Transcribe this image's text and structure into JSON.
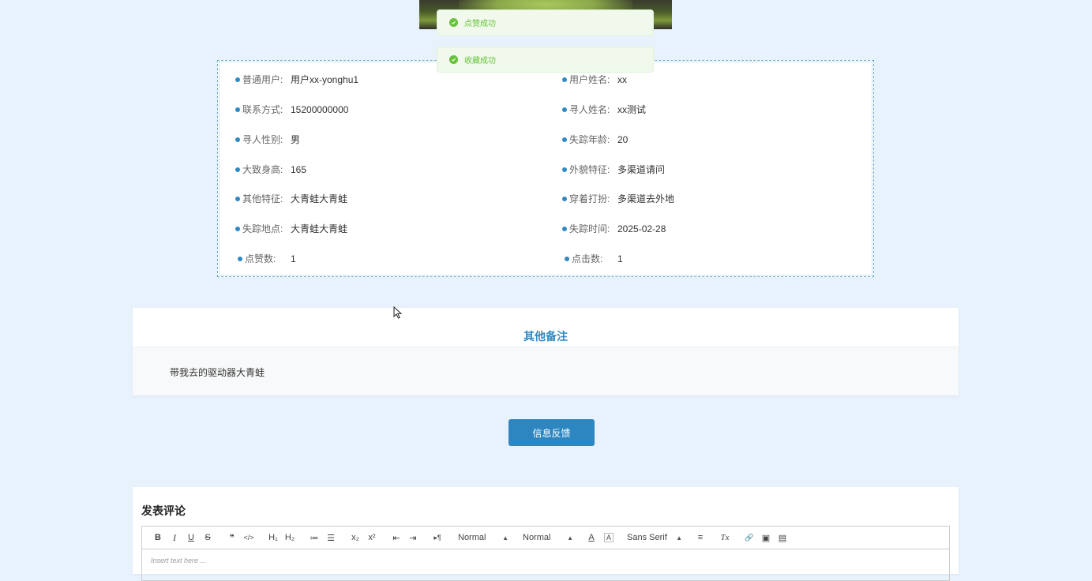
{
  "toasts": {
    "like": "点赞成功",
    "favorite": "收藏成功"
  },
  "info": {
    "left": [
      {
        "label": "普通用户:",
        "value": "用户xx-yonghu1"
      },
      {
        "label": "联系方式:",
        "value": "15200000000"
      },
      {
        "label": "寻人性别:",
        "value": "男"
      },
      {
        "label": "大致身高:",
        "value": "165"
      },
      {
        "label": "其他特征:",
        "value": "大青蛙大青蛙"
      },
      {
        "label": "失踪地点:",
        "value": "大青蛙大青蛙"
      },
      {
        "label": "点赞数:",
        "value": "1"
      }
    ],
    "right": [
      {
        "label": "用户姓名:",
        "value": "xx"
      },
      {
        "label": "寻人姓名:",
        "value": "xx测试"
      },
      {
        "label": "失踪年龄:",
        "value": "20"
      },
      {
        "label": "外貌特征:",
        "value": "多渠道请问"
      },
      {
        "label": "穿着打扮:",
        "value": "多渠道去外地"
      },
      {
        "label": "失踪时间:",
        "value": "2025-02-28"
      },
      {
        "label": "点击数:",
        "value": "1"
      }
    ]
  },
  "remarks": {
    "title": "其他备注",
    "text": "带我去的驱动器大青蛙"
  },
  "feedback_button": "信息反馈",
  "comment": {
    "title": "发表评论",
    "toolbar": {
      "bold": "B",
      "italic": "I",
      "underline": "U",
      "strike": "S",
      "blockquote": "❞",
      "code": "</>",
      "h1": "H₁",
      "h2": "H₂",
      "ordered_list": "≔",
      "bullet_list": "☰",
      "subscript": "x₂",
      "superscript": "x²",
      "outdent": "⇤",
      "indent": "⇥",
      "direction": "▸¶",
      "size_select": "Normal",
      "header_select": "Normal",
      "color": "A",
      "background": "A",
      "font_select": "Sans Serif",
      "align": "≡",
      "clean": "Tx",
      "link": "🔗",
      "image": "▣",
      "video": "▤"
    },
    "placeholder": "Insert text here ..."
  },
  "colors": {
    "accent": "#2f8ac4",
    "success": "#67c23a",
    "background": "#e8f2fd"
  }
}
